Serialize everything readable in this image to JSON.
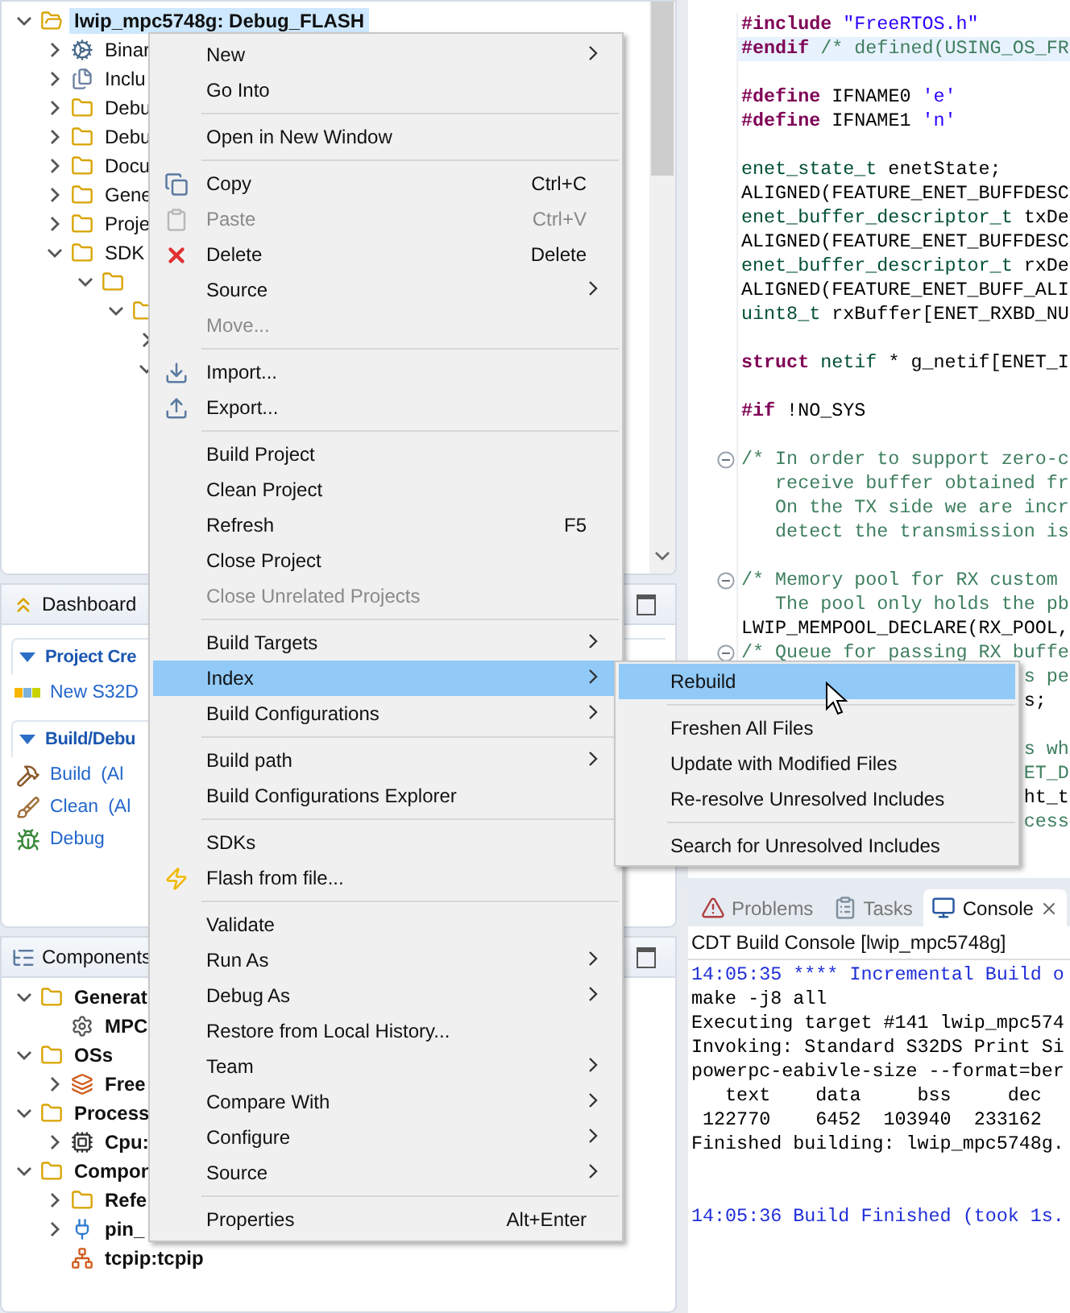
{
  "explorer": {
    "tree": [
      {
        "label": "lwip_mpc5748g: Debug_FLASH",
        "kind": "project",
        "expanded": true,
        "selected": true,
        "children": [
          {
            "label": "Binar",
            "kind": "binary",
            "expanded": false,
            "selected": false
          },
          {
            "label": "Inclu",
            "kind": "includes",
            "expanded": false,
            "selected": false
          },
          {
            "label": "Debu",
            "kind": "folder",
            "expanded": false,
            "selected": false
          },
          {
            "label": "Debu",
            "kind": "folder",
            "expanded": false,
            "selected": false
          },
          {
            "label": "Docu",
            "kind": "folder",
            "expanded": false,
            "selected": false
          },
          {
            "label": "Gene",
            "kind": "folder",
            "expanded": false,
            "selected": false
          },
          {
            "label": "Proje",
            "kind": "folder",
            "expanded": false,
            "selected": false
          },
          {
            "label": "SDK",
            "kind": "folder",
            "expanded": true,
            "selected": false,
            "children": [
              {
                "kind": "folder",
                "expanded": true,
                "children": [
                  {
                    "kind": "folder",
                    "expanded": true,
                    "children": [
                      {
                        "expanded": false
                      },
                      {
                        "expanded": true
                      }
                    ]
                  }
                ]
              }
            ]
          }
        ]
      }
    ]
  },
  "dashboard": {
    "tab": "Dashboard",
    "sections": [
      {
        "title": "Project Cre",
        "expanded": true,
        "items": [
          {
            "label": "New S32D",
            "kind": "nxp"
          }
        ]
      },
      {
        "title": "Build/Debu",
        "expanded": true,
        "items": [
          {
            "label": "Build",
            "note": "(Al",
            "kind": "hammer"
          },
          {
            "label": "Clean",
            "note": "(Al",
            "kind": "broom"
          },
          {
            "label": "Debug",
            "kind": "bug"
          }
        ]
      }
    ]
  },
  "components": {
    "tab": "Components",
    "tree": [
      {
        "label": "Generat",
        "kind": "folder",
        "expanded": true,
        "selected": false,
        "children": [
          {
            "label": "MPC",
            "kind": "gear",
            "selected": false
          }
        ]
      },
      {
        "label": "OSs",
        "kind": "folder",
        "expanded": true,
        "selected": false,
        "children": [
          {
            "label": "Free",
            "kind": "os",
            "expanded": false,
            "selected": false
          }
        ]
      },
      {
        "label": "Process",
        "kind": "folder",
        "expanded": true,
        "selected": false,
        "children": [
          {
            "label": "Cpu:",
            "kind": "cpu",
            "expanded": false,
            "selected": false
          }
        ]
      },
      {
        "label": "Compon",
        "kind": "folder",
        "expanded": true,
        "selected": false,
        "children": [
          {
            "label": "Refe",
            "kind": "folder",
            "expanded": false,
            "selected": false
          },
          {
            "label": "pin_",
            "kind": "pin",
            "expanded": false,
            "selected": false
          },
          {
            "label": "tcpip:tcpip",
            "kind": "tcpip",
            "selected": false
          }
        ]
      }
    ]
  },
  "editor": {
    "lines": [
      {
        "kind": "code",
        "current": false,
        "parts": [
          {
            "text": "#include",
            "kind": "directive"
          },
          {
            "text": " \"FreeRTOS.h\"",
            "kind": "string"
          }
        ]
      },
      {
        "kind": "code",
        "current": true,
        "parts": [
          {
            "text": "#endif",
            "kind": "directive"
          },
          {
            "text": " /* defined(USING_OS_FR",
            "kind": "comment"
          }
        ]
      },
      {
        "kind": "blank"
      },
      {
        "kind": "code",
        "current": false,
        "parts": [
          {
            "text": "#define",
            "kind": "directive"
          },
          {
            "text": " IFNAME0 ",
            "kind": "plain"
          },
          {
            "text": "'e'",
            "kind": "string"
          }
        ]
      },
      {
        "kind": "code",
        "current": false,
        "parts": [
          {
            "text": "#define",
            "kind": "directive"
          },
          {
            "text": " IFNAME1 ",
            "kind": "plain"
          },
          {
            "text": "'n'",
            "kind": "string"
          }
        ]
      },
      {
        "kind": "blank"
      },
      {
        "kind": "code",
        "current": false,
        "parts": [
          {
            "text": "enet_state_t",
            "kind": "type"
          },
          {
            "text": " enetState;",
            "kind": "plain"
          }
        ]
      },
      {
        "kind": "code",
        "current": false,
        "parts": [
          {
            "text": "ALIGNED(FEATURE_ENET_BUFFDESC",
            "kind": "plain"
          }
        ]
      },
      {
        "kind": "code",
        "current": false,
        "parts": [
          {
            "text": "enet_buffer_descriptor_t",
            "kind": "type"
          },
          {
            "text": " txDe",
            "kind": "plain"
          }
        ]
      },
      {
        "kind": "code",
        "current": false,
        "parts": [
          {
            "text": "ALIGNED(FEATURE_ENET_BUFFDESC",
            "kind": "plain"
          }
        ]
      },
      {
        "kind": "code",
        "current": false,
        "parts": [
          {
            "text": "enet_buffer_descriptor_t",
            "kind": "type"
          },
          {
            "text": " rxDe",
            "kind": "plain"
          }
        ]
      },
      {
        "kind": "code",
        "current": false,
        "parts": [
          {
            "text": "ALIGNED(FEATURE_ENET_BUFF_ALI",
            "kind": "plain"
          }
        ]
      },
      {
        "kind": "code",
        "current": false,
        "parts": [
          {
            "text": "uint8_t",
            "kind": "type"
          },
          {
            "text": " rxBuffer[ENET_RXBD_NU",
            "kind": "plain"
          }
        ]
      },
      {
        "kind": "blank"
      },
      {
        "kind": "code",
        "current": false,
        "parts": [
          {
            "text": "struct",
            "kind": "keyword"
          },
          {
            "text": " netif",
            "kind": "type"
          },
          {
            "text": " * g_netif[ENET_I",
            "kind": "plain"
          }
        ]
      },
      {
        "kind": "blank"
      },
      {
        "kind": "code",
        "current": false,
        "parts": [
          {
            "text": "#if",
            "kind": "directive"
          },
          {
            "text": " !NO_SYS",
            "kind": "plain"
          }
        ]
      },
      {
        "kind": "blank"
      },
      {
        "kind": "code",
        "current": false,
        "fold": true,
        "parts": [
          {
            "text": "/* In order to support zero-c",
            "kind": "comment"
          }
        ]
      },
      {
        "kind": "code",
        "current": false,
        "parts": [
          {
            "text": "   receive buffer obtained fr",
            "kind": "comment"
          }
        ]
      },
      {
        "kind": "code",
        "current": false,
        "parts": [
          {
            "text": "   On the TX side we are incr",
            "kind": "comment"
          }
        ]
      },
      {
        "kind": "code",
        "current": false,
        "parts": [
          {
            "text": "   detect the transmission is",
            "kind": "comment"
          }
        ]
      },
      {
        "kind": "blank"
      },
      {
        "kind": "code",
        "current": false,
        "fold": true,
        "parts": [
          {
            "text": "/* Memory pool for RX custom",
            "kind": "comment"
          }
        ]
      },
      {
        "kind": "code",
        "current": false,
        "parts": [
          {
            "text": "   The pool only holds the pb",
            "kind": "comment"
          }
        ]
      },
      {
        "kind": "code",
        "current": false,
        "parts": [
          {
            "text": "LWIP_MEMPOOL_DECLARE(RX_POOL,",
            "kind": "plain"
          }
        ]
      },
      {
        "kind": "code",
        "current": false,
        "fold": true,
        "parts": [
          {
            "text": "/* Queue for passing RX buffe",
            "kind": "comment"
          }
        ]
      },
      {
        "kind": "tail",
        "current": false,
        "parts": [
          {
            "text": "s pe",
            "kind": "comment"
          }
        ]
      },
      {
        "kind": "tail",
        "current": false,
        "parts": [
          {
            "text": "s;",
            "kind": "plain"
          }
        ]
      },
      {
        "kind": "blank"
      },
      {
        "kind": "tail",
        "current": false,
        "parts": [
          {
            "text": "s wh",
            "kind": "comment"
          }
        ]
      },
      {
        "kind": "tail",
        "current": false,
        "parts": [
          {
            "text": "ET_D",
            "kind": "comment"
          }
        ]
      },
      {
        "kind": "tail",
        "current": false,
        "parts": [
          {
            "text": "ht_t",
            "kind": "plain"
          }
        ]
      },
      {
        "kind": "tail",
        "current": false,
        "parts": [
          {
            "text": "cess",
            "kind": "comment"
          }
        ]
      }
    ]
  },
  "console": {
    "tabs": [
      {
        "label": "Problems",
        "kind": "problems",
        "selected": false
      },
      {
        "label": "Tasks",
        "kind": "tasks",
        "selected": false
      },
      {
        "label": "Console",
        "kind": "console",
        "selected": true
      }
    ],
    "title": "CDT Build Console [lwip_mpc5748g]",
    "lines": [
      {
        "kind": "info",
        "text": "14:05:35 **** Incremental Build o"
      },
      {
        "kind": "plain",
        "text": "make -j8 all"
      },
      {
        "kind": "plain",
        "text": "Executing target #141 lwip_mpc574"
      },
      {
        "kind": "plain",
        "text": "Invoking: Standard S32DS Print Si"
      },
      {
        "kind": "plain",
        "text": "powerpc-eabivle-size --format=ber"
      },
      {
        "kind": "plain",
        "text": "   text    data     bss     dec"
      },
      {
        "kind": "plain",
        "text": " 122770    6452  103940  233162"
      },
      {
        "kind": "plain",
        "text": "Finished building: lwip_mpc5748g."
      },
      {
        "kind": "blank"
      },
      {
        "kind": "blank"
      },
      {
        "kind": "info",
        "text": "14:05:36 Build Finished (took 1s."
      }
    ]
  },
  "context_menu": {
    "items": [
      {
        "kind": "plain",
        "label": "New",
        "submenu": true,
        "selected": false,
        "disabled": false
      },
      {
        "kind": "plain",
        "label": "Go Into",
        "submenu": false,
        "selected": false,
        "disabled": false
      },
      {
        "kind": "separator"
      },
      {
        "kind": "plain",
        "label": "Open in New Window",
        "submenu": false,
        "selected": false,
        "disabled": false
      },
      {
        "kind": "separator"
      },
      {
        "kind": "copy",
        "label": "Copy",
        "shortcut": "Ctrl+C",
        "submenu": false,
        "selected": false,
        "disabled": false
      },
      {
        "kind": "paste",
        "label": "Paste",
        "shortcut": "Ctrl+V",
        "submenu": false,
        "selected": false,
        "disabled": true
      },
      {
        "kind": "delete",
        "label": "Delete",
        "shortcut": "Delete",
        "submenu": false,
        "selected": false,
        "disabled": false
      },
      {
        "kind": "plain",
        "label": "Source",
        "submenu": true,
        "selected": false,
        "disabled": false
      },
      {
        "kind": "plain",
        "label": "Move...",
        "submenu": false,
        "selected": false,
        "disabled": true
      },
      {
        "kind": "separator"
      },
      {
        "kind": "import",
        "label": "Import...",
        "submenu": false,
        "selected": false,
        "disabled": false
      },
      {
        "kind": "export",
        "label": "Export...",
        "submenu": false,
        "selected": false,
        "disabled": false
      },
      {
        "kind": "separator"
      },
      {
        "kind": "plain",
        "label": "Build Project",
        "submenu": false,
        "selected": false,
        "disabled": false
      },
      {
        "kind": "plain",
        "label": "Clean Project",
        "submenu": false,
        "selected": false,
        "disabled": false
      },
      {
        "kind": "plain",
        "label": "Refresh",
        "shortcut": "F5",
        "submenu": false,
        "selected": false,
        "disabled": false
      },
      {
        "kind": "plain",
        "label": "Close Project",
        "submenu": false,
        "selected": false,
        "disabled": false
      },
      {
        "kind": "plain",
        "label": "Close Unrelated Projects",
        "submenu": false,
        "selected": false,
        "disabled": true
      },
      {
        "kind": "separator"
      },
      {
        "kind": "plain",
        "label": "Build Targets",
        "submenu": true,
        "selected": false,
        "disabled": false
      },
      {
        "kind": "plain",
        "label": "Index",
        "submenu": true,
        "selected": true,
        "disabled": false
      },
      {
        "kind": "plain",
        "label": "Build Configurations",
        "submenu": true,
        "selected": false,
        "disabled": false
      },
      {
        "kind": "separator"
      },
      {
        "kind": "plain",
        "label": "Build path",
        "submenu": true,
        "selected": false,
        "disabled": false
      },
      {
        "kind": "plain",
        "label": "Build Configurations Explorer",
        "submenu": false,
        "selected": false,
        "disabled": false
      },
      {
        "kind": "separator"
      },
      {
        "kind": "plain",
        "label": "SDKs",
        "submenu": false,
        "selected": false,
        "disabled": false
      },
      {
        "kind": "flash",
        "label": "Flash from file...",
        "submenu": false,
        "selected": false,
        "disabled": false
      },
      {
        "kind": "separator"
      },
      {
        "kind": "plain",
        "label": "Validate",
        "submenu": false,
        "selected": false,
        "disabled": false
      },
      {
        "kind": "plain",
        "label": "Run As",
        "submenu": true,
        "selected": false,
        "disabled": false
      },
      {
        "kind": "plain",
        "label": "Debug As",
        "submenu": true,
        "selected": false,
        "disabled": false
      },
      {
        "kind": "plain",
        "label": "Restore from Local History...",
        "submenu": false,
        "selected": false,
        "disabled": false
      },
      {
        "kind": "plain",
        "label": "Team",
        "submenu": true,
        "selected": false,
        "disabled": false
      },
      {
        "kind": "plain",
        "label": "Compare With",
        "submenu": true,
        "selected": false,
        "disabled": false
      },
      {
        "kind": "plain",
        "label": "Configure",
        "submenu": true,
        "selected": false,
        "disabled": false
      },
      {
        "kind": "plain",
        "label": "Source",
        "submenu": true,
        "selected": false,
        "disabled": false
      },
      {
        "kind": "separator"
      },
      {
        "kind": "plain",
        "label": "Properties",
        "shortcut": "Alt+Enter",
        "submenu": false,
        "selected": false,
        "disabled": false
      }
    ]
  },
  "submenu": {
    "items": [
      {
        "kind": "plain",
        "label": "Rebuild",
        "selected": true,
        "disabled": false
      },
      {
        "kind": "separator"
      },
      {
        "kind": "plain",
        "label": "Freshen All Files",
        "selected": false,
        "disabled": false
      },
      {
        "kind": "plain",
        "label": "Update with Modified Files",
        "selected": false,
        "disabled": false
      },
      {
        "kind": "plain",
        "label": "Re-resolve Unresolved Includes",
        "selected": false,
        "disabled": false
      },
      {
        "kind": "separator"
      },
      {
        "kind": "plain",
        "label": "Search for Unresolved Includes",
        "selected": false,
        "disabled": false
      }
    ]
  }
}
